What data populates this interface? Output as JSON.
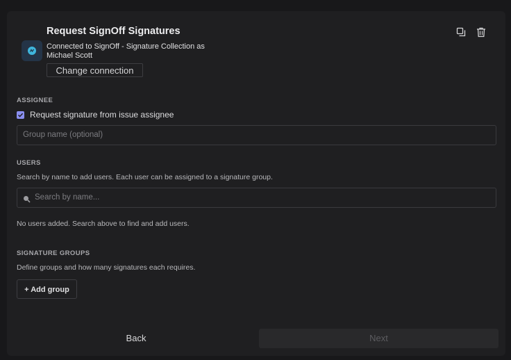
{
  "header": {
    "title": "Request SignOff Signatures",
    "connection_text": "Connected to SignOff - Signature Collection as Michael Scott",
    "change_connection_label": "Change connection",
    "app_icon": "signoff-app-icon",
    "duplicate_icon": "duplicate-icon",
    "delete_icon": "trash-icon"
  },
  "assignee": {
    "section_label": "ASSIGNEE",
    "checkbox_label": "Request signature from issue assignee",
    "checkbox_checked": true,
    "group_placeholder": "Group name (optional)"
  },
  "users": {
    "section_label": "USERS",
    "help_text": "Search by name to add users. Each user can be assigned to a signature group.",
    "search_placeholder": "Search by name...",
    "empty_text": "No users added. Search above to find and add users."
  },
  "signature_groups": {
    "section_label": "SIGNATURE GROUPS",
    "help_text": "Define groups and how many signatures each requires.",
    "add_group_label": "+ Add group"
  },
  "footer": {
    "back_label": "Back",
    "next_label": "Next"
  },
  "colors": {
    "accent": "#8a8ff0",
    "app_icon_bg": "#243447",
    "app_icon_fg": "#3fb6dd"
  }
}
